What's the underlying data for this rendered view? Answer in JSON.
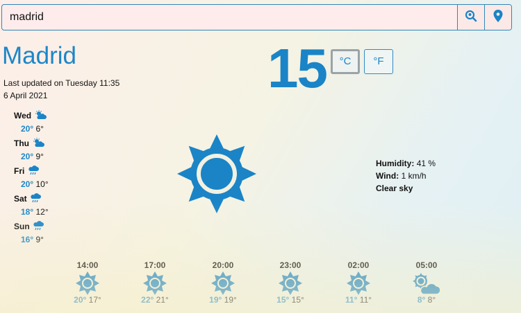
{
  "search": {
    "value": "madrid"
  },
  "current": {
    "city": "Madrid",
    "updated_line1": "Last updated on Tuesday 11:35",
    "updated_line2": "6 April 2021",
    "temperature": "15",
    "unit_c": "°C",
    "unit_f": "°F",
    "condition_icon": "sun-icon"
  },
  "details": {
    "humidity_label": "Humidity:",
    "humidity_value": "41 %",
    "wind_label": "Wind:",
    "wind_value": "1 km/h",
    "condition": "Clear sky"
  },
  "daily": [
    {
      "day": "Wed",
      "icon": "sun-cloud-icon",
      "hi": "20°",
      "lo": "6°"
    },
    {
      "day": "Thu",
      "icon": "sun-cloud-icon",
      "hi": "20°",
      "lo": "9°"
    },
    {
      "day": "Fri",
      "icon": "cloud-rain-icon",
      "hi": "20°",
      "lo": "10°"
    },
    {
      "day": "Sat",
      "icon": "cloud-rain-icon",
      "hi": "18°",
      "lo": "12°"
    },
    {
      "day": "Sun",
      "icon": "cloud-rain-icon",
      "hi": "16°",
      "lo": "9°"
    }
  ],
  "hourly": [
    {
      "time": "14:00",
      "icon": "sun-icon",
      "hi": "20°",
      "lo": "17°"
    },
    {
      "time": "17:00",
      "icon": "sun-icon",
      "hi": "22°",
      "lo": "21°"
    },
    {
      "time": "20:00",
      "icon": "sun-icon",
      "hi": "19°",
      "lo": "19°"
    },
    {
      "time": "23:00",
      "icon": "sun-icon",
      "hi": "15°",
      "lo": "15°"
    },
    {
      "time": "02:00",
      "icon": "sun-icon",
      "hi": "11°",
      "lo": "11°"
    },
    {
      "time": "05:00",
      "icon": "sun-cloud-icon",
      "hi": "8°",
      "lo": "8°"
    }
  ],
  "colors": {
    "accent": "#1a84c7",
    "border": "#2f86b9"
  }
}
